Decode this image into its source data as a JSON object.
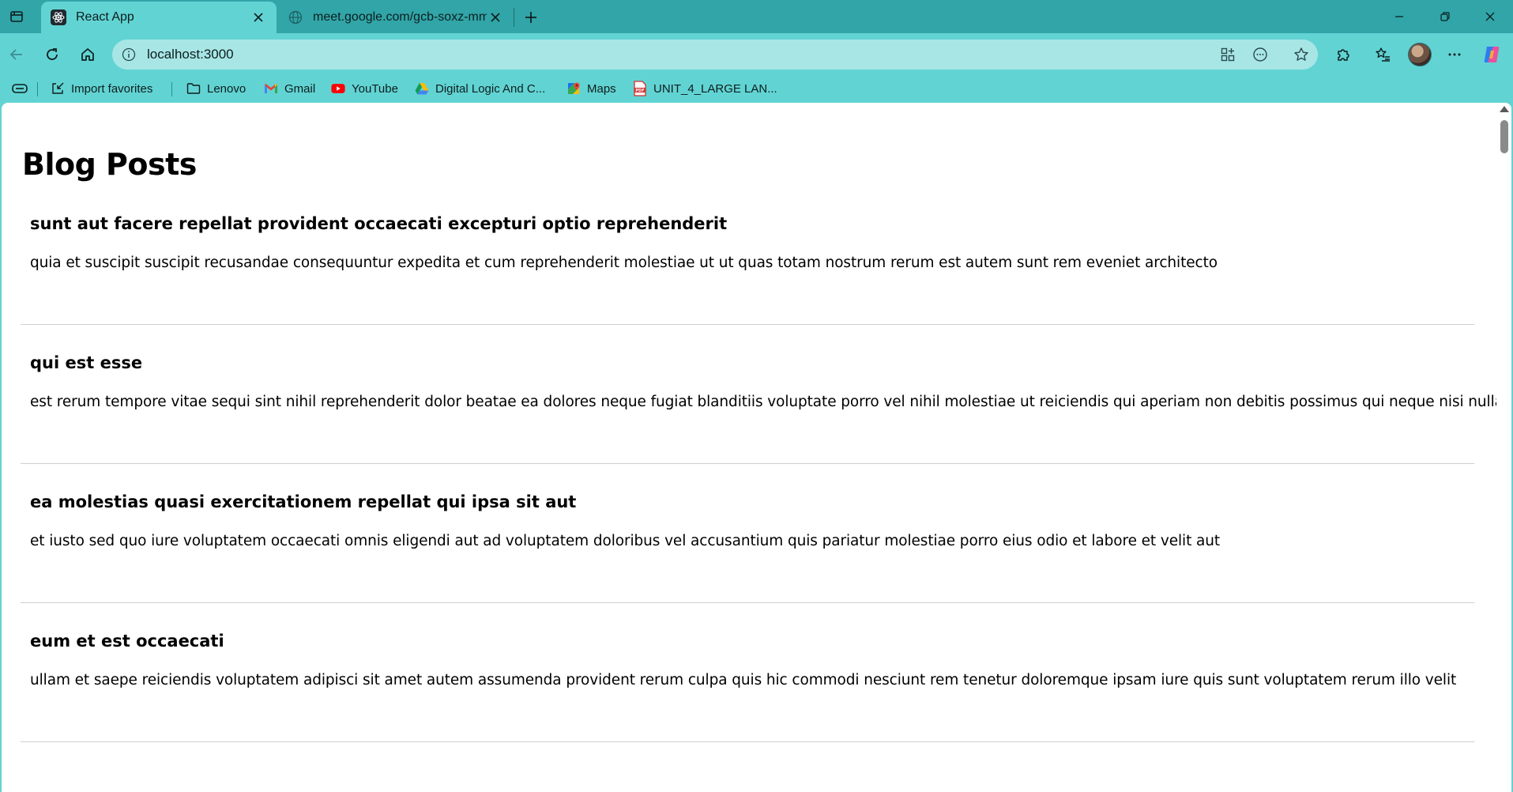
{
  "browser": {
    "tabs": [
      {
        "title": "React App",
        "icon": "react-icon",
        "active": true
      },
      {
        "title": "meet.google.com/gcb-soxz-mmw",
        "icon": "globe-icon",
        "active": false
      }
    ],
    "address": {
      "url": "localhost:3000"
    },
    "bookmarks": [
      {
        "label": "Import favorites",
        "icon": "import-favorites-icon"
      },
      {
        "label": "Lenovo",
        "icon": "folder-icon"
      },
      {
        "label": "Gmail",
        "icon": "gmail-icon"
      },
      {
        "label": "YouTube",
        "icon": "youtube-icon"
      },
      {
        "label": "Digital Logic And C...",
        "icon": "google-drive-icon"
      },
      {
        "label": "Maps",
        "icon": "google-maps-icon"
      },
      {
        "label": "UNIT_4_LARGE LAN...",
        "icon": "pdf-icon"
      }
    ],
    "colors": {
      "tabstrip": "#31a5a8",
      "toolbar": "#62d3d3",
      "omnibox": "#a8e6e6"
    }
  },
  "page": {
    "title": "Blog Posts",
    "posts": [
      {
        "title": "sunt aut facere repellat provident occaecati excepturi optio reprehenderit",
        "body": "quia et suscipit suscipit recusandae consequuntur expedita et cum reprehenderit molestiae ut ut quas totam nostrum rerum est autem sunt rem eveniet architecto"
      },
      {
        "title": "qui est esse",
        "body": "est rerum tempore vitae sequi sint nihil reprehenderit dolor beatae ea dolores neque fugiat blanditiis voluptate porro vel nihil molestiae ut reiciendis qui aperiam non debitis possimus qui neque nisi nulla"
      },
      {
        "title": "ea molestias quasi exercitationem repellat qui ipsa sit aut",
        "body": "et iusto sed quo iure voluptatem occaecati omnis eligendi aut ad voluptatem doloribus vel accusantium quis pariatur molestiae porro eius odio et labore et velit aut"
      },
      {
        "title": "eum et est occaecati",
        "body": "ullam et saepe reiciendis voluptatem adipisci sit amet autem assumenda provident rerum culpa quis hic commodi nesciunt rem tenetur doloremque ipsam iure quis sunt voluptatem rerum illo velit"
      }
    ]
  }
}
